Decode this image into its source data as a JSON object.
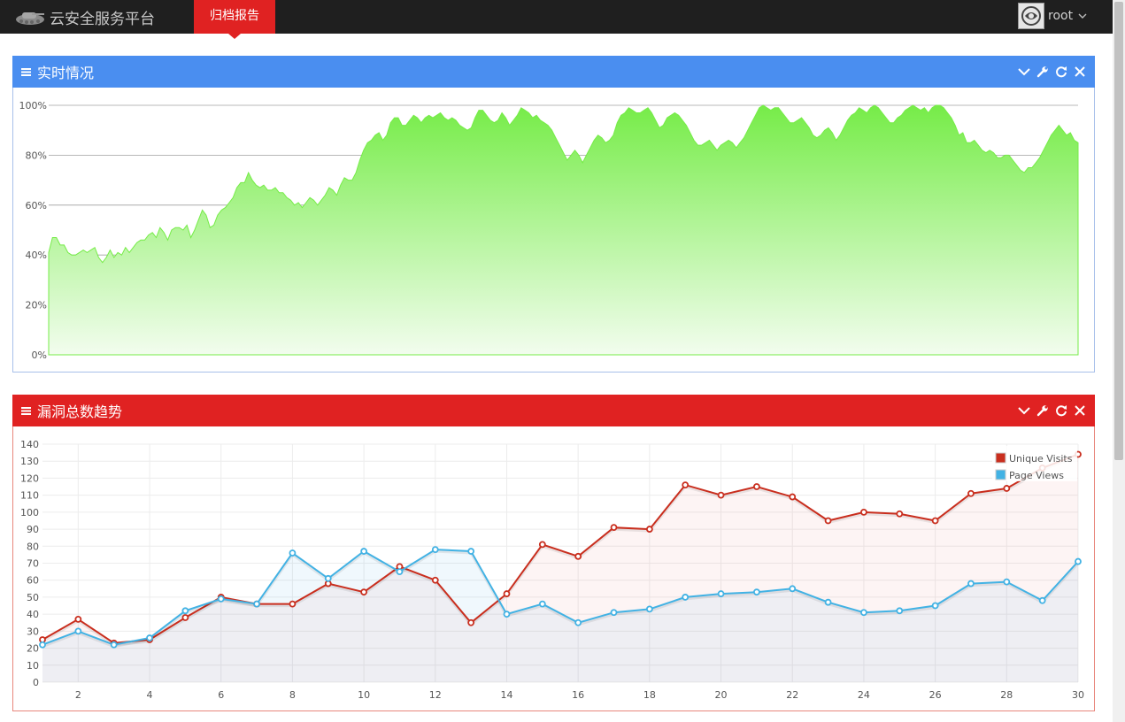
{
  "topbar": {
    "brand": "云安全服务平台",
    "nav_tab": "归档报告",
    "username": "root"
  },
  "panels": {
    "realtime": {
      "title": "实时情况",
      "color": "#4a8ef0"
    },
    "trend": {
      "title": "漏洞总数趋势",
      "color": "#e02222"
    }
  },
  "icons": {
    "header": [
      "menu-icon"
    ],
    "tools": [
      "chevron-down-icon",
      "wrench-icon",
      "refresh-icon",
      "close-icon"
    ]
  },
  "chart_data": [
    {
      "type": "area",
      "y_tick_labels": [
        "0%",
        "20%",
        "40%",
        "60%",
        "80%",
        "100%"
      ],
      "ylim": [
        0,
        100
      ],
      "grid": true,
      "color": "#76ec48",
      "values": [
        41,
        47,
        47,
        44,
        44,
        41,
        40,
        40,
        41,
        42,
        41,
        42,
        43,
        39,
        37,
        39,
        42,
        39,
        41,
        40,
        43,
        41,
        43,
        45,
        46,
        46,
        48,
        49,
        47,
        51,
        49,
        46,
        50,
        51,
        51,
        50,
        52,
        47,
        50,
        54,
        58,
        56,
        51,
        52,
        56,
        58,
        59,
        61,
        63,
        67,
        69,
        69,
        73,
        70,
        68,
        67,
        68,
        66,
        66,
        67,
        65,
        65,
        63,
        62,
        60,
        61,
        59,
        61,
        63,
        62,
        60,
        62,
        64,
        67,
        66,
        64,
        68,
        71,
        70,
        70,
        73,
        78,
        82,
        85,
        86,
        88,
        89,
        86,
        88,
        93,
        95,
        95,
        92,
        92,
        94,
        96,
        95,
        93,
        95,
        96,
        95,
        96,
        97,
        95,
        94,
        95,
        94,
        92,
        91,
        90,
        91,
        95,
        98,
        98,
        96,
        94,
        93,
        94,
        97,
        95,
        92,
        94,
        96,
        99,
        98,
        97,
        95,
        96,
        94,
        93,
        92,
        90,
        87,
        84,
        81,
        78,
        80,
        82,
        80,
        77,
        80,
        83,
        86,
        88,
        87,
        85,
        86,
        88,
        93,
        96,
        97,
        99,
        98,
        97,
        97,
        98,
        99,
        97,
        94,
        91,
        92,
        95,
        96,
        97,
        96,
        94,
        92,
        89,
        86,
        84,
        84,
        85,
        86,
        84,
        82,
        84,
        85,
        86,
        85,
        83,
        85,
        87,
        90,
        93,
        96,
        99,
        100,
        99,
        98,
        99,
        99,
        97,
        95,
        93,
        93,
        94,
        95,
        93,
        91,
        88,
        87,
        88,
        90,
        91,
        89,
        86,
        88,
        91,
        94,
        96,
        97,
        99,
        98,
        97,
        99,
        100,
        99,
        97,
        95,
        93,
        93,
        95,
        96,
        98,
        99,
        100,
        99,
        98,
        99,
        97,
        99,
        100,
        100,
        99,
        97,
        95,
        92,
        88,
        89,
        85,
        85,
        86,
        84,
        82,
        81,
        82,
        81,
        79,
        79,
        80,
        80,
        78,
        76,
        74,
        73,
        75,
        75,
        77,
        79,
        82,
        85,
        88,
        90,
        92,
        90,
        88,
        89,
        86,
        85
      ]
    },
    {
      "type": "line",
      "x": [
        1,
        2,
        3,
        4,
        5,
        6,
        7,
        8,
        9,
        10,
        11,
        12,
        13,
        14,
        15,
        16,
        17,
        18,
        19,
        20,
        21,
        22,
        23,
        24,
        25,
        26,
        27,
        28,
        29,
        30
      ],
      "x_ticks": [
        2,
        4,
        6,
        8,
        10,
        12,
        14,
        16,
        18,
        20,
        22,
        24,
        26,
        28,
        30
      ],
      "ylim": [
        0,
        140
      ],
      "y_ticks": [
        0,
        10,
        20,
        30,
        40,
        50,
        60,
        70,
        80,
        90,
        100,
        110,
        120,
        130,
        140
      ],
      "grid": true,
      "legend_position": "top-right",
      "series": [
        {
          "name": "Unique Visits",
          "color": "#c92e1e",
          "values": [
            25,
            37,
            23,
            25,
            38,
            50,
            46,
            46,
            58,
            53,
            68,
            60,
            35,
            52,
            81,
            74,
            91,
            90,
            116,
            110,
            115,
            109,
            95,
            100,
            99,
            95,
            111,
            114,
            126,
            134
          ]
        },
        {
          "name": "Page Views",
          "color": "#42b2e4",
          "values": [
            22,
            30,
            22,
            26,
            42,
            49,
            46,
            76,
            61,
            77,
            65,
            78,
            77,
            40,
            46,
            35,
            41,
            43,
            50,
            52,
            53,
            55,
            47,
            41,
            42,
            45,
            58,
            59,
            48,
            71
          ]
        }
      ]
    }
  ]
}
